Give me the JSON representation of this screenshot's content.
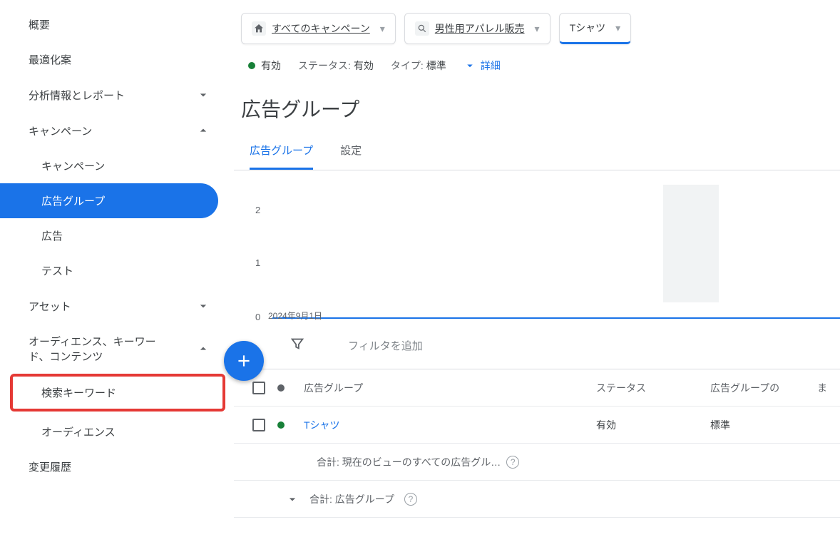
{
  "sidebar": {
    "overview": "概要",
    "recommendations": "最適化案",
    "insights": "分析情報とレポート",
    "campaigns": "キャンペーン",
    "sub_campaigns": "キャンペーン",
    "sub_adgroups": "広告グループ",
    "sub_ads": "広告",
    "sub_tests": "テスト",
    "assets": "アセット",
    "audiences": "オーディエンス、キーワード、コンテンツ",
    "sub_search_keywords": "検索キーワード",
    "sub_audiences": "オーディエンス",
    "change_history": "変更履歴"
  },
  "breadcrumb": {
    "all_campaigns": "すべてのキャンペーン",
    "campaign": "男性用アパレル販売",
    "adgroup": "Tシャツ"
  },
  "status": {
    "enabled": "有効",
    "status_label": "ステータス:",
    "status_value": "有効",
    "type_label": "タイプ:",
    "type_value": "標準",
    "details": "詳細"
  },
  "page_title": "広告グループ",
  "tabs": {
    "adgroups": "広告グループ",
    "settings": "設定"
  },
  "chart_data": {
    "type": "line",
    "y_ticks": [
      "2",
      "1",
      "0"
    ],
    "x_start": "2024年9月1日",
    "series": [
      {
        "name": "value",
        "values_flat_at": 0
      }
    ]
  },
  "filter": {
    "placeholder": "フィルタを追加"
  },
  "table": {
    "headers": {
      "adgroup": "広告グループ",
      "status": "ステータス",
      "type": "広告グループの",
      "last": "ま"
    },
    "row1": {
      "name": "Tシャツ",
      "status": "有効",
      "type": "標準"
    },
    "total_current": "合計: 現在のビューのすべての広告グル…",
    "total_adgroups": "合計: 広告グループ"
  }
}
